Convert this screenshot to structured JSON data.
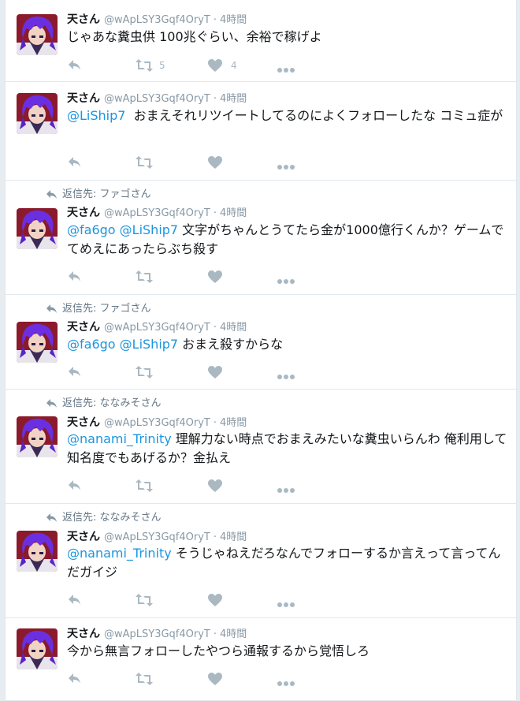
{
  "colors": {
    "link": "#1b95e0",
    "icon": "#aab8c2",
    "meta": "#8899a6",
    "text": "#14171a"
  },
  "icons": {
    "reply": "reply-icon",
    "retweet": "retweet-icon",
    "like": "heart-icon",
    "more": "more-icon"
  },
  "tweets": [
    {
      "name": "天さん",
      "handle": "@wApLSY3Gqf4OryT",
      "sep": "·",
      "time": "4時間",
      "parts": [
        {
          "t": "じゃあな糞虫供 100兆ぐらい、余裕で稼げよ"
        }
      ],
      "rt_count": "5",
      "like_count": "4"
    },
    {
      "name": "天さん",
      "handle": "@wApLSY3Gqf4OryT",
      "sep": "·",
      "time": "4時間",
      "parts": [
        {
          "t": "@LiShip7",
          "m": true
        },
        {
          "t": "  おまえそれリツイートしてるのによくフォローしたな コミュ症が"
        }
      ]
    },
    {
      "reply_to": "返信先: ファゴさん",
      "name": "天さん",
      "handle": "@wApLSY3Gqf4OryT",
      "sep": "·",
      "time": "4時間",
      "parts": [
        {
          "t": "@fa6go",
          "m": true
        },
        {
          "t": " "
        },
        {
          "t": "@LiShip7",
          "m": true
        },
        {
          "t": " 文字がちゃんとうてたら金が1000億行くんか？ゲームでてめえにあったらぶち殺す"
        }
      ]
    },
    {
      "reply_to": "返信先: ファゴさん",
      "name": "天さん",
      "handle": "@wApLSY3Gqf4OryT",
      "sep": "·",
      "time": "4時間",
      "parts": [
        {
          "t": "@fa6go",
          "m": true
        },
        {
          "t": " "
        },
        {
          "t": "@LiShip7",
          "m": true
        },
        {
          "t": " おまえ殺すからな"
        }
      ]
    },
    {
      "reply_to": "返信先: ななみそさん",
      "name": "天さん",
      "handle": "@wApLSY3Gqf4OryT",
      "sep": "·",
      "time": "4時間",
      "parts": [
        {
          "t": "@nanami_Trinity",
          "m": true
        },
        {
          "t": " 理解力ない時点でおまえみたいな糞虫いらんわ 俺利用して知名度でもあげるか？金払え"
        }
      ]
    },
    {
      "reply_to": "返信先: ななみそさん",
      "name": "天さん",
      "handle": "@wApLSY3Gqf4OryT",
      "sep": "·",
      "time": "4時間",
      "parts": [
        {
          "t": "@nanami_Trinity",
          "m": true
        },
        {
          "t": " そうじゃねえだろなんでフォローするか言えって言ってんだガイジ"
        }
      ]
    },
    {
      "name": "天さん",
      "handle": "@wApLSY3Gqf4OryT",
      "sep": "·",
      "time": "4時間",
      "parts": [
        {
          "t": "今から無言フォローしたやつら通報するから覚悟しろ"
        }
      ]
    }
  ]
}
